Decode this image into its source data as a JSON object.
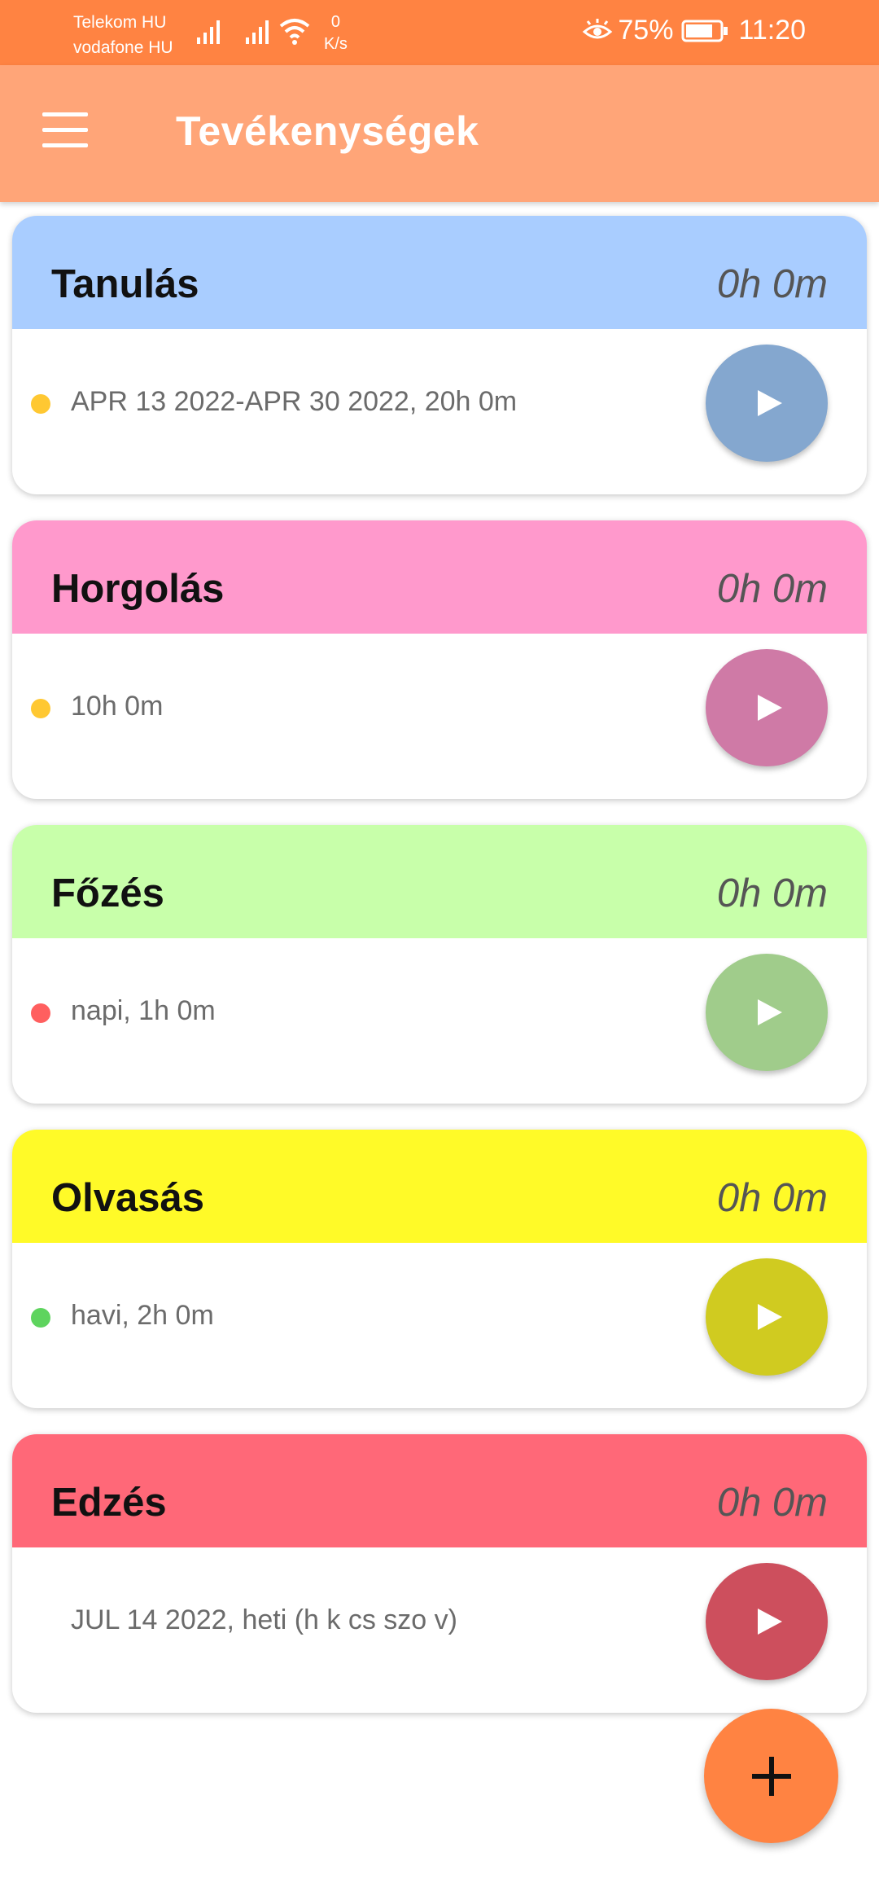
{
  "status_bar": {
    "carrier1": "Telekom HU",
    "carrier2": "vodafone HU",
    "speed_value": "0",
    "speed_unit": "K/s",
    "battery": "75%",
    "time": "11:20"
  },
  "app_bar": {
    "title": "Tevékenységek"
  },
  "activities": [
    {
      "name": "Tanulás",
      "time": "0h 0m",
      "detail": "APR 13 2022-APR 30 2022, 20h 0m",
      "header_color": "#a9cdff",
      "button_color": "#84a7cf",
      "dot_color": "#ffc832"
    },
    {
      "name": "Horgolás",
      "time": "0h 0m",
      "detail": "10h 0m",
      "header_color": "#ff99cc",
      "button_color": "#cf7aa6",
      "dot_color": "#ffc832"
    },
    {
      "name": "Főzés",
      "time": "0h 0m",
      "detail": "napi, 1h 0m",
      "header_color": "#c8ffaa",
      "button_color": "#a0cc8b",
      "dot_color": "#ff5f5f"
    },
    {
      "name": "Olvasás",
      "time": "0h 0m",
      "detail": "havi, 2h 0m",
      "header_color": "#fffa28",
      "button_color": "#d0cb20",
      "dot_color": "#5ed45e"
    },
    {
      "name": "Edzés",
      "time": "0h 0m",
      "detail": "JUL 14 2022, heti (h k cs szo v)",
      "header_color": "#ff6878",
      "button_color": "#cd4f5d",
      "dot_color": null
    }
  ],
  "icons": {
    "menu": "menu-icon",
    "play": "play-icon",
    "add": "plus-icon"
  }
}
